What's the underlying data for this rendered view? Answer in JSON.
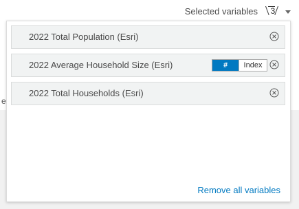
{
  "header": {
    "label": "Selected variables",
    "count": "3"
  },
  "variables": [
    {
      "label": "2022 Total Population (Esri)"
    },
    {
      "label": "2022 Average Household Size (Esri)",
      "toggle": {
        "options": [
          "#",
          "Index"
        ],
        "selected": "#"
      }
    },
    {
      "label": "2022 Total Households (Esri)"
    }
  ],
  "footer": {
    "remove_all_label": "Remove all variables"
  },
  "background": {
    "partial_letter": "e"
  },
  "colors": {
    "accent": "#0079c1",
    "item_bg": "#f1f3f3",
    "item_border": "#dadcdc",
    "text": "#4a4a4a"
  }
}
